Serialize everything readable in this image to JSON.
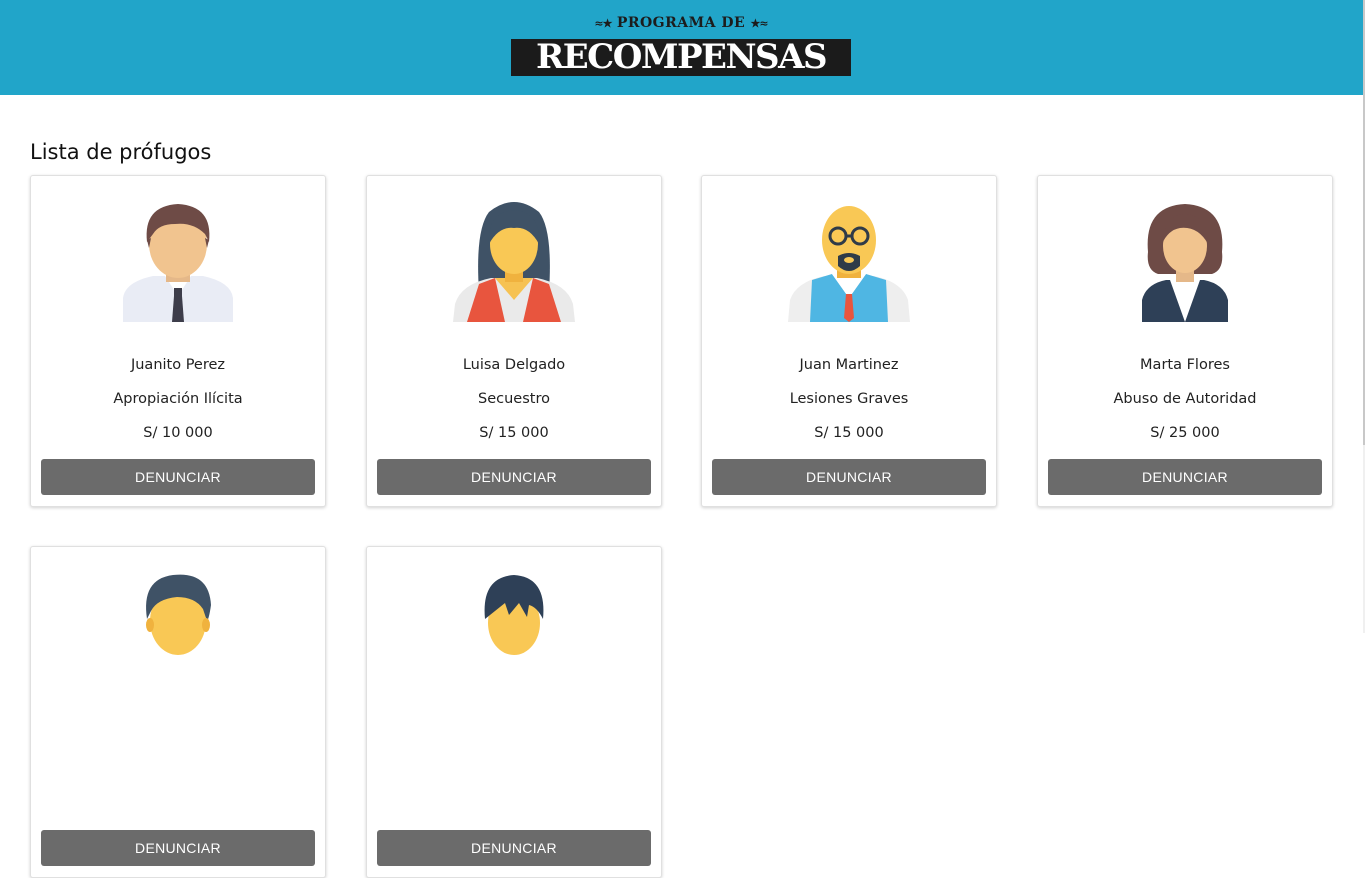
{
  "header": {
    "logo_top": "PROGRAMA DE",
    "logo_main": "RECOMPENSAS"
  },
  "page_title": "Lista de prófugos",
  "button_label": "DENUNCIAR",
  "fugitives": [
    {
      "name": "Juanito Perez",
      "crime": "Apropiación Ilícita",
      "reward": "S/ 10 000",
      "avatar": "man-tie-icon"
    },
    {
      "name": "Luisa Delgado",
      "crime": "Secuestro",
      "reward": "S/ 15 000",
      "avatar": "woman-long-hair-icon"
    },
    {
      "name": "Juan Martinez",
      "crime": "Lesiones Graves",
      "reward": "S/ 15 000",
      "avatar": "bald-man-glasses-icon"
    },
    {
      "name": "Marta Flores",
      "crime": "Abuso de Autoridad",
      "reward": "S/ 25 000",
      "avatar": "woman-bob-hair-icon"
    },
    {
      "name": "",
      "crime": "",
      "reward": "",
      "avatar": "man-quiff-icon"
    },
    {
      "name": "",
      "crime": "",
      "reward": "",
      "avatar": "boy-bangs-icon"
    }
  ],
  "colors": {
    "header": "#21a5c9",
    "button": "#6b6b6b"
  }
}
